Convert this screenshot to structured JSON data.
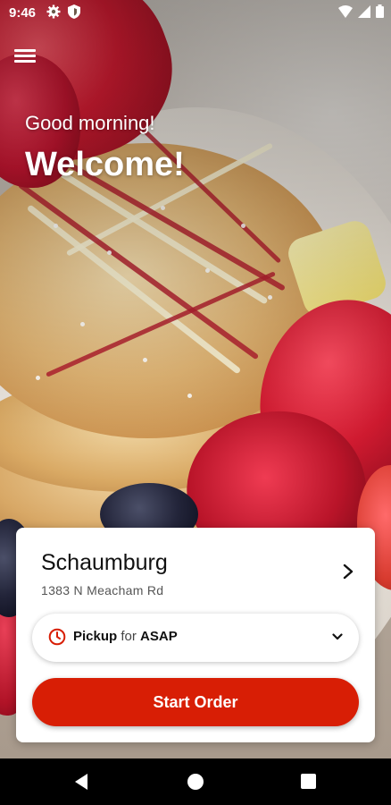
{
  "status_bar": {
    "time": "9:46",
    "icons": [
      "gear-icon",
      "shield-icon",
      "wifi-icon",
      "signal-icon",
      "battery-icon"
    ]
  },
  "header": {
    "menu_icon": "hamburger-menu-icon",
    "greeting": "Good morning!",
    "welcome": "Welcome!"
  },
  "location": {
    "name": "Schaumburg",
    "address": "1383 N Meacham Rd"
  },
  "pickup": {
    "mode": "Pickup",
    "connector": "for",
    "time": "ASAP"
  },
  "actions": {
    "start_order": "Start Order"
  },
  "colors": {
    "accent": "#d81e05",
    "clock_icon": "#d81e05"
  }
}
